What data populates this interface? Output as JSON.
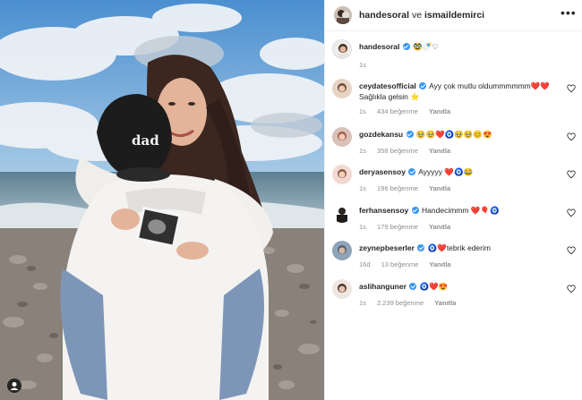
{
  "header": {
    "user1": "handesoral",
    "conjunction": "ve",
    "user2": "ismaildemirci"
  },
  "caption": {
    "username": "handesoral",
    "text": "🥸🍼♡",
    "time": "1s"
  },
  "comments": [
    {
      "username": "ceydatesofficial",
      "verified": true,
      "text": "Ayy çok mutlu oldummmmmm❤️❤️ Sağlıkla gelsin ⭐",
      "time": "1s",
      "likes": "434 beğenme",
      "reply": "Yanıtla"
    },
    {
      "username": "gozdekansu",
      "verified": true,
      "text": "🥹🥹❤️🧿🥹🥹😊😍",
      "time": "1s",
      "likes": "358 beğenme",
      "reply": "Yanıtla"
    },
    {
      "username": "deryasensoy",
      "verified": true,
      "text": "Ayyyyy ❤️🧿😂",
      "time": "1s",
      "likes": "196 beğenme",
      "reply": "Yanıtla"
    },
    {
      "username": "ferhansensoy",
      "verified": true,
      "text": "Handecimmm ❤️🎈🧿",
      "time": "1s",
      "likes": "179 beğenme",
      "reply": "Yanıtla"
    },
    {
      "username": "zeynepbeserler",
      "verified": true,
      "text": "🧿❤️tebrik ederim",
      "time": "16d",
      "likes": "13 beğenme",
      "reply": "Yanıtla"
    },
    {
      "username": "aslihanguner",
      "verified": true,
      "text": "🧿❤️😍",
      "time": "1s",
      "likes": "2.239 beğenme",
      "reply": "Yanıtla"
    }
  ],
  "photo": {
    "cap_text": "dad"
  },
  "colors": {
    "verified": "#3897f0",
    "muted": "#8e8e8e",
    "text": "#262626"
  }
}
